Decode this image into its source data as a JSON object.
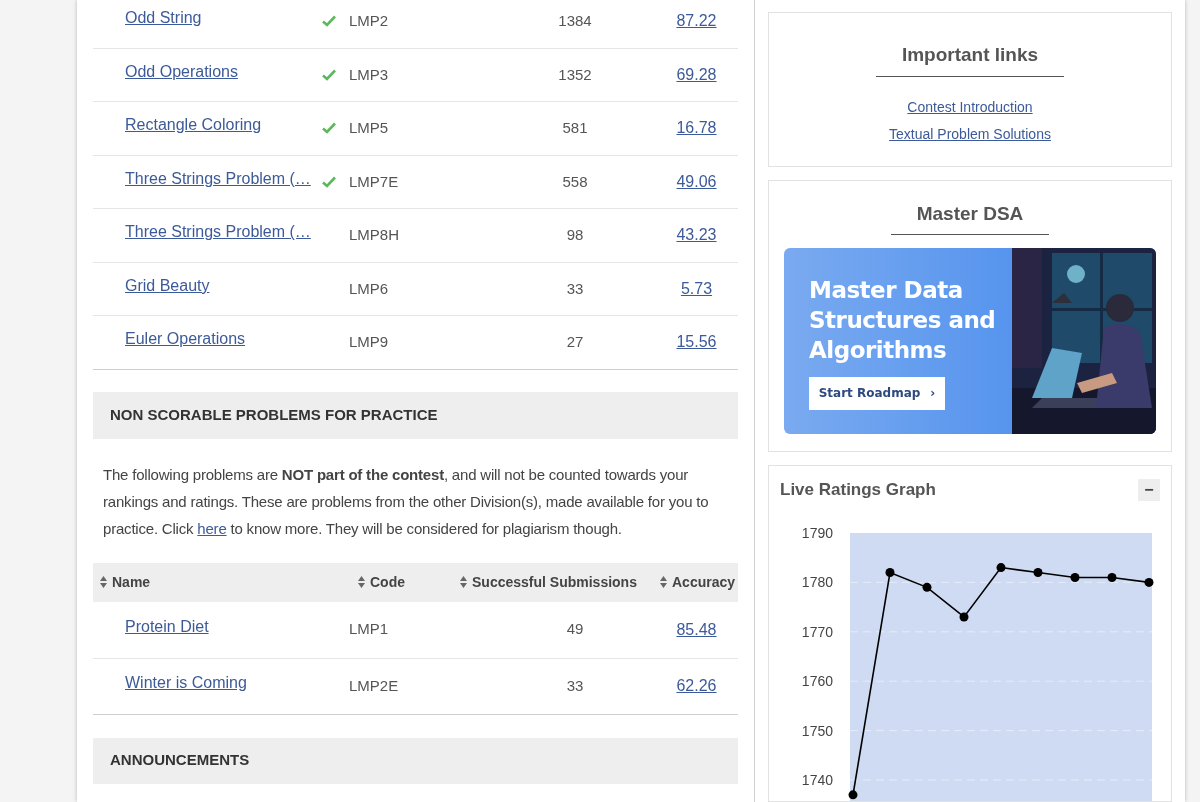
{
  "problems_table": {
    "rows": [
      {
        "name": "Odd String",
        "solved": true,
        "code": "LMP2",
        "submissions": "1384",
        "accuracy": "87.22"
      },
      {
        "name": "Odd Operations",
        "solved": true,
        "code": "LMP3",
        "submissions": "1352",
        "accuracy": "69.28"
      },
      {
        "name": "Rectangle Coloring",
        "solved": true,
        "code": "LMP5",
        "submissions": "581",
        "accuracy": "16.78"
      },
      {
        "name": "Three Strings Problem (…",
        "solved": true,
        "code": "LMP7E",
        "submissions": "558",
        "accuracy": "49.06"
      },
      {
        "name": "Three Strings Problem (…",
        "solved": false,
        "code": "LMP8H",
        "submissions": "98",
        "accuracy": "43.23"
      },
      {
        "name": "Grid Beauty",
        "solved": false,
        "code": "LMP6",
        "submissions": "33",
        "accuracy": "5.73"
      },
      {
        "name": "Euler Operations",
        "solved": false,
        "code": "LMP9",
        "submissions": "27",
        "accuracy": "15.56"
      }
    ]
  },
  "practice_section": {
    "heading": "NON SCORABLE PROBLEMS FOR PRACTICE",
    "text_before_link": "The following problems are **NOT part of the contest**, and will not be counted towards your rankings and ratings. These are problems from the other Division(s), made available for you to practice. Click",
    "link": "here",
    "text_after_link": "to know more. They will be considered for plagiarism though.",
    "columns": [
      "Name",
      "Code",
      "Successful Submissions",
      "Accuracy"
    ],
    "rows": [
      {
        "name": "Protein Diet",
        "code": "LMP1",
        "submissions": "49",
        "accuracy": "85.48"
      },
      {
        "name": "Winter is Coming",
        "code": "LMP2E",
        "submissions": "33",
        "accuracy": "62.26"
      }
    ]
  },
  "announcements": {
    "heading": "ANNOUNCEMENTS"
  },
  "important_links": {
    "title": "Important links",
    "links": [
      "Contest Introduction",
      "Textual Problem Solutions"
    ]
  },
  "master_dsa": {
    "title": "Master DSA",
    "banner": {
      "headline": "Master Data Structures and Algorithms",
      "button": "Start Roadmap",
      "button_icon": "›"
    }
  },
  "live_ratings": {
    "title": "Live Ratings Graph",
    "collapse_button": "−",
    "chart_data": {
      "type": "line",
      "ylim": [
        1734,
        1790
      ],
      "yticks": [
        1740,
        1750,
        1760,
        1770,
        1780,
        1790
      ],
      "grid": true,
      "series": [
        {
          "color": "#000000",
          "marker": "circle",
          "values": [
            1737,
            1782,
            1779,
            1773,
            1783,
            1782,
            1781,
            1781,
            1780
          ]
        }
      ]
    }
  }
}
